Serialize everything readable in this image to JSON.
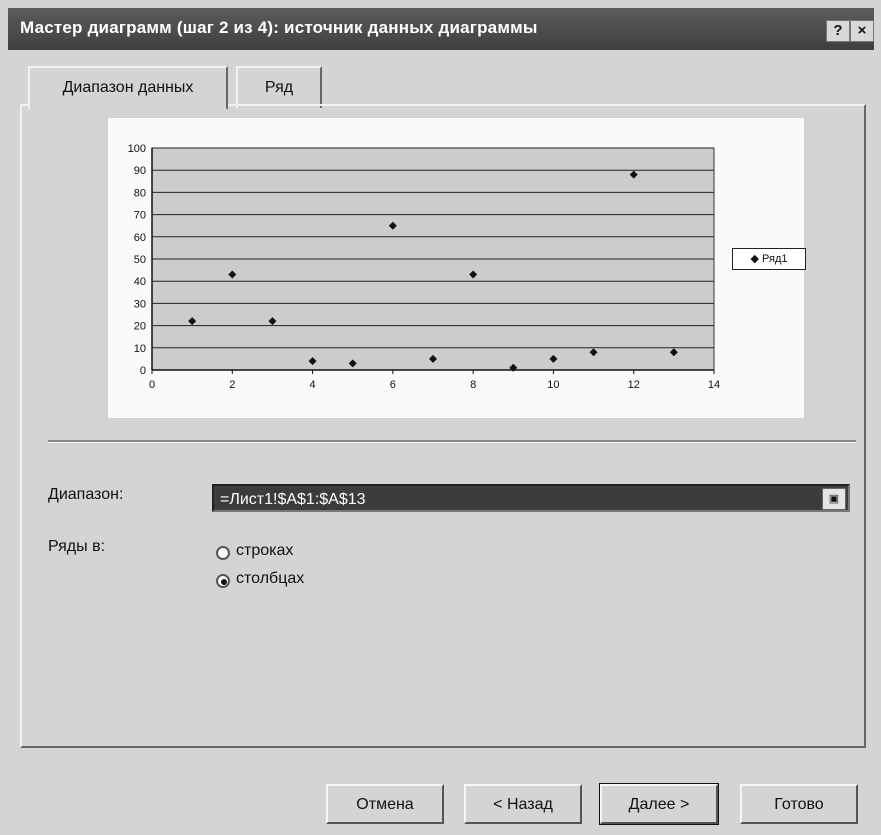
{
  "window": {
    "title": "Мастер диаграмм (шаг 2 из 4): источник данных диаграммы",
    "help_label": "?",
    "close_label": "×"
  },
  "tabs": [
    {
      "label": "Диапазон данных",
      "active": true
    },
    {
      "label": "Ряд",
      "active": false
    }
  ],
  "chart_data": {
    "type": "scatter",
    "series": [
      {
        "name": "Ряд1",
        "x": [
          1,
          2,
          3,
          4,
          5,
          6,
          7,
          8,
          9,
          10,
          11,
          12,
          13
        ],
        "y": [
          22,
          43,
          22,
          4,
          3,
          65,
          5,
          43,
          1,
          5,
          8,
          88,
          8
        ]
      }
    ],
    "xlim": [
      0,
      14
    ],
    "ylim": [
      0,
      100
    ],
    "x_ticks": [
      0,
      2,
      4,
      6,
      8,
      10,
      12,
      14
    ],
    "y_ticks": [
      0,
      10,
      20,
      30,
      40,
      50,
      60,
      70,
      80,
      90,
      100
    ],
    "grid": true,
    "legend_position": "right",
    "plot_background": "#cccccc",
    "marker": "diamond"
  },
  "range": {
    "label": "Диапазон:",
    "value": "=Лист1!$A$1:$A$13"
  },
  "series_in": {
    "label": "Ряды в:",
    "options": [
      {
        "label": "строках",
        "checked": false
      },
      {
        "label": "столбцах",
        "checked": true
      }
    ]
  },
  "buttons": {
    "cancel": "Отмена",
    "back": "< Назад",
    "next": "Далее >",
    "finish": "Готово"
  }
}
